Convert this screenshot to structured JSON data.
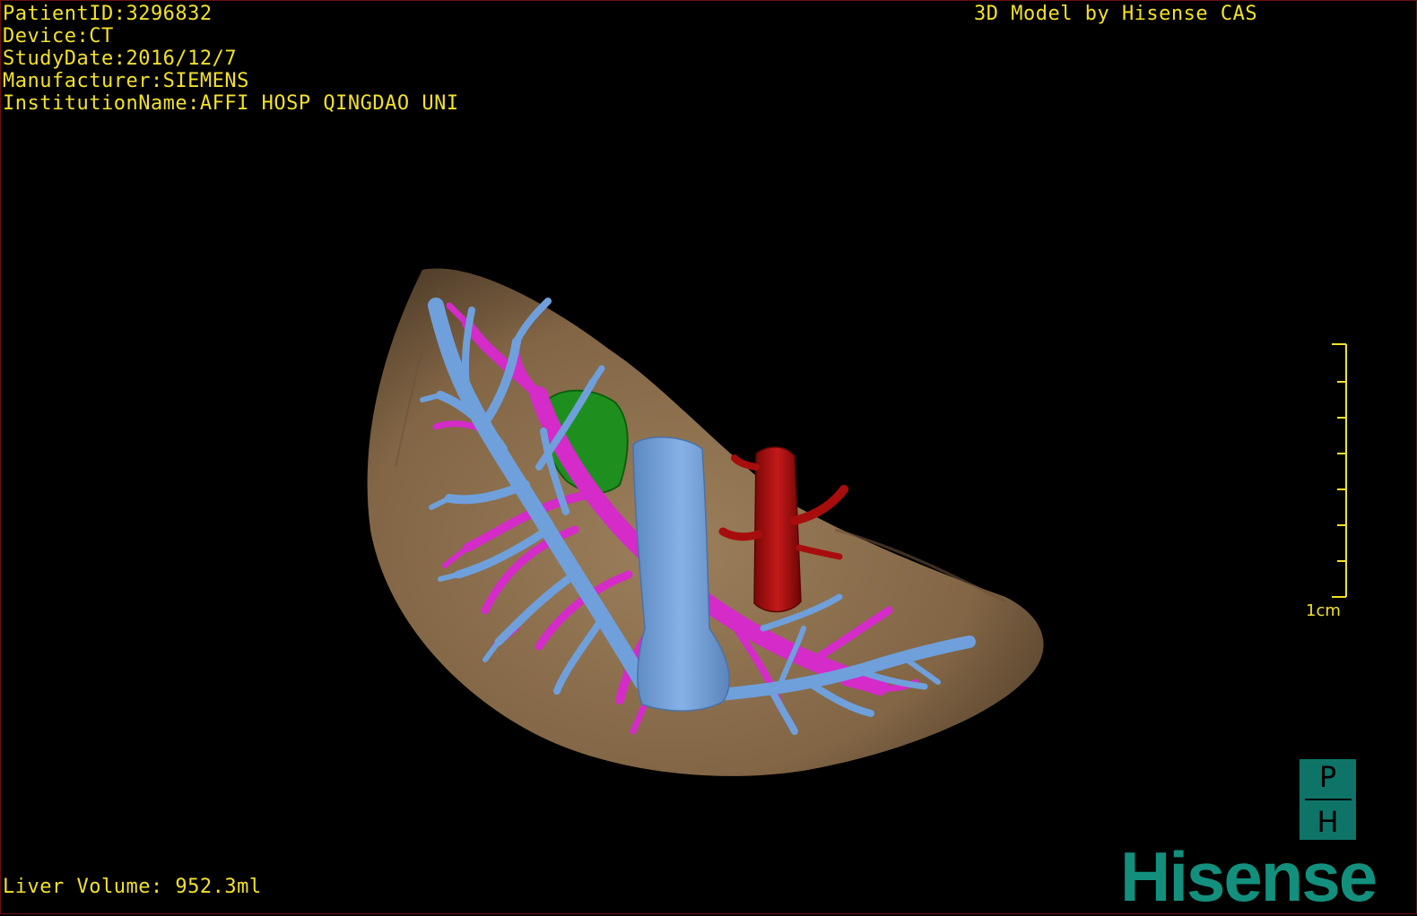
{
  "study_info": {
    "patient_id": "PatientID:3296832",
    "device": "Device:CT",
    "study_date": "StudyDate:2016/12/7",
    "manufacturer": "Manufacturer:SIEMENS",
    "institution": "InstitutionName:AFFI HOSP QINGDAO UNI"
  },
  "credit": "3D Model by Hisense CAS",
  "volume": "Liver Volume: 952.3ml",
  "scale_bar": {
    "label": "1cm",
    "tick_count": 8
  },
  "badge": {
    "top": "P",
    "bottom": "H"
  },
  "brand": "Hisense",
  "colors": {
    "overlay_text": "#f2e12b",
    "liver": "#a07f5a",
    "hepatic_vein": "#6fa0dc",
    "portal_vein": "#d42bc9",
    "lesion": "#1e8f1e",
    "artery": "#b00d0d",
    "brand": "#12907d"
  }
}
